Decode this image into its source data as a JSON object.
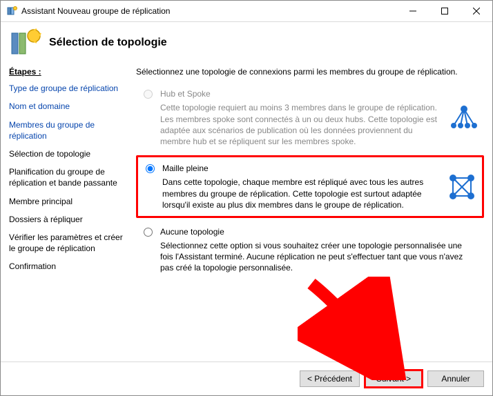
{
  "window": {
    "title": "Assistant Nouveau groupe de réplication"
  },
  "header": {
    "title": "Sélection de topologie"
  },
  "steps": {
    "heading": "Étapes :",
    "items": [
      "Type de groupe de réplication",
      "Nom et domaine",
      "Membres du groupe de réplication",
      "Sélection de topologie",
      "Planification du groupe de réplication et bande passante",
      "Membre principal",
      "Dossiers à répliquer",
      "Vérifier les paramètres et créer le groupe de réplication",
      "Confirmation"
    ],
    "current_index": 3
  },
  "content": {
    "intro": "Sélectionnez une topologie de connexions parmi les membres du groupe de réplication.",
    "options": [
      {
        "id": "hub",
        "label": "Hub et Spoke",
        "desc": "Cette topologie requiert au moins 3 membres dans le groupe de réplication. Les membres spoke sont connectés à un ou deux hubs. Cette topologie est adaptée aux scénarios de publication où les données proviennent du membre hub et se répliquent sur les membres spoke.",
        "enabled": false,
        "selected": false
      },
      {
        "id": "fullmesh",
        "label": "Maille pleine",
        "desc": "Dans cette topologie, chaque membre est répliqué avec tous les autres membres du groupe de réplication. Cette topologie est surtout adaptée lorsqu'il existe au plus dix membres dans le groupe de réplication.",
        "enabled": true,
        "selected": true
      },
      {
        "id": "none",
        "label": "Aucune topologie",
        "desc": "Sélectionnez cette option si vous souhaitez créer une topologie personnalisée une fois l'Assistant terminé. Aucune réplication ne peut s'effectuer tant que vous n'avez pas créé la topologie personnalisée.",
        "enabled": true,
        "selected": false
      }
    ]
  },
  "buttons": {
    "prev": "< Précédent",
    "next": "Suivant >",
    "cancel": "Annuler"
  },
  "colors": {
    "highlight": "#ff0000",
    "accent": "#1d6fd1"
  }
}
